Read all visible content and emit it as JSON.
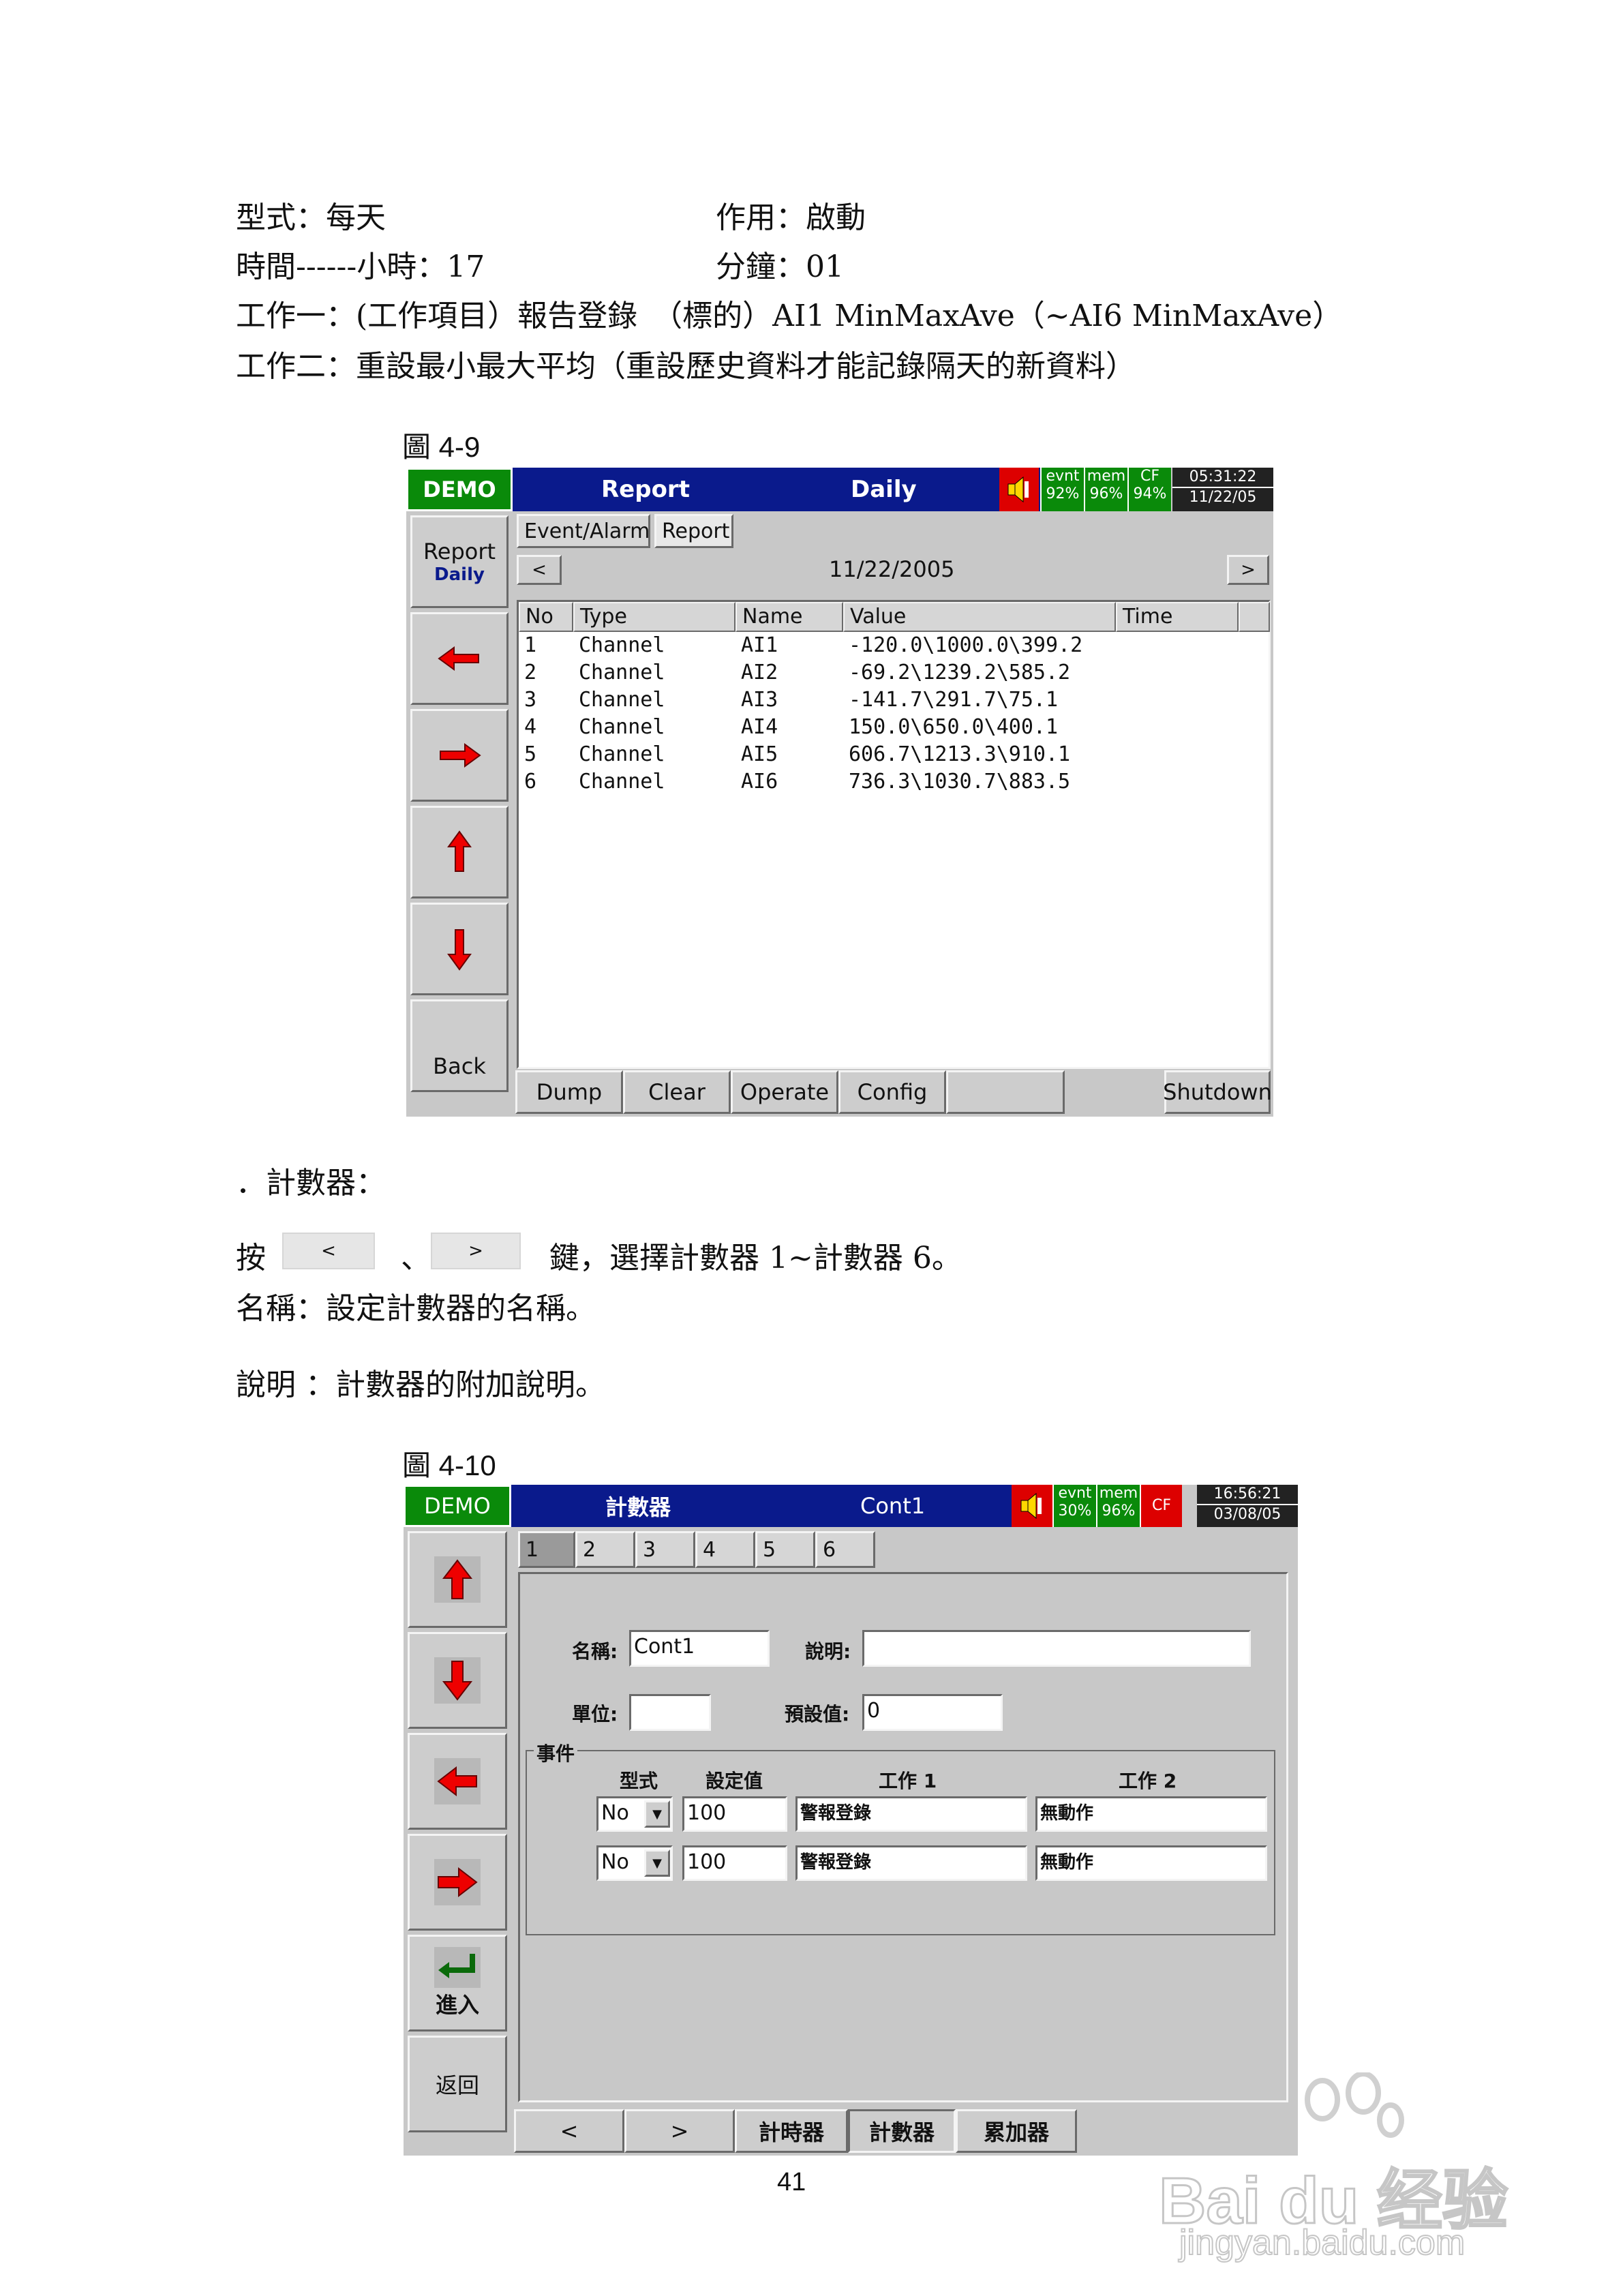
{
  "text": {
    "l1a": "型式：每天",
    "l1b": "作用：啟動",
    "l2a": "時間------小時：17",
    "l2b": "分鐘：01",
    "l3": "工作一：(工作項目）報告登錄　（標的）AI1 MinMaxAve（~AI6 MinMaxAve）",
    "l4": "工作二：重設最小最大平均（重設歷史資料才能記錄隔天的新資料）",
    "fig1": "圖 4-9",
    "section": "．計數器：",
    "press": "按",
    "sep": "、",
    "press_tail": "鍵，選擇計數器 1~計數器 6。",
    "name_line": "名稱：設定計數器的名稱。",
    "desc_line": "說明 ：計數器的附加說明。",
    "fig2": "圖 4-10",
    "page_no": "41",
    "inline_prev": "<",
    "inline_next": ">"
  },
  "s1": {
    "demo": "DEMO",
    "title": "Report",
    "mode": "Daily",
    "status": [
      {
        "top": "evnt",
        "bottom": "92%"
      },
      {
        "top": "mem",
        "bottom": "96%"
      },
      {
        "top": "CF",
        "bottom": "94%"
      }
    ],
    "time": "05:31:22",
    "date": "11/22/05",
    "side_title": "Report",
    "side_sub": "Daily",
    "back": "Back",
    "tab_event": "Event/Alarm",
    "tab_report": "Report",
    "prev": "<",
    "next": ">",
    "nav_date": "11/22/2005",
    "columns": [
      "No",
      "Type",
      "Name",
      "Value",
      "Time"
    ],
    "rows": [
      {
        "no": "1",
        "type": "Channel",
        "name": "AI1",
        "value": "-120.0\\1000.0\\399.2"
      },
      {
        "no": "2",
        "type": "Channel",
        "name": "AI2",
        "value": "-69.2\\1239.2\\585.2"
      },
      {
        "no": "3",
        "type": "Channel",
        "name": "AI3",
        "value": "-141.7\\291.7\\75.1"
      },
      {
        "no": "4",
        "type": "Channel",
        "name": "AI4",
        "value": "150.0\\650.0\\400.1"
      },
      {
        "no": "5",
        "type": "Channel",
        "name": "AI5",
        "value": "606.7\\1213.3\\910.1"
      },
      {
        "no": "6",
        "type": "Channel",
        "name": "AI6",
        "value": "736.3\\1030.7\\883.5"
      }
    ],
    "bottom": [
      "Dump",
      "Clear",
      "Operate",
      "Config"
    ],
    "shutdown": "Shutdown",
    "accent_red": "#dd0000",
    "header_blue": "#0a1a8c",
    "demo_green": "#0a8a0a"
  },
  "s2": {
    "demo": "DEMO",
    "title": "計數器",
    "name": "Cont1",
    "status": [
      {
        "top": "evnt",
        "bottom": "30%"
      },
      {
        "top": "mem",
        "bottom": "96%"
      }
    ],
    "cf": "CF",
    "time": "16:56:21",
    "date": "03/08/05",
    "enter": "進入",
    "back": "返回",
    "tabs": [
      "1",
      "2",
      "3",
      "4",
      "5",
      "6"
    ],
    "label_name": "名稱:",
    "value_name": "Cont1",
    "label_desc": "說明:",
    "value_desc": "",
    "label_unit": "單位:",
    "value_unit": "",
    "label_preset": "預設值:",
    "value_preset": "0",
    "group": "事件",
    "col_type": "型式",
    "col_set": "設定值",
    "col_job1": "工作 1",
    "col_job2": "工作 2",
    "events": [
      {
        "type": "No",
        "set": "100",
        "job1": "警報登錄",
        "job2": "無動作"
      },
      {
        "type": "No",
        "set": "100",
        "job1": "警報登錄",
        "job2": "無動作"
      }
    ],
    "bottom": [
      "<",
      ">",
      "計時器",
      "計數器",
      "累加器"
    ]
  },
  "watermark": {
    "brand": "Bai du 经验",
    "url": "jingyan.baidu.com"
  }
}
